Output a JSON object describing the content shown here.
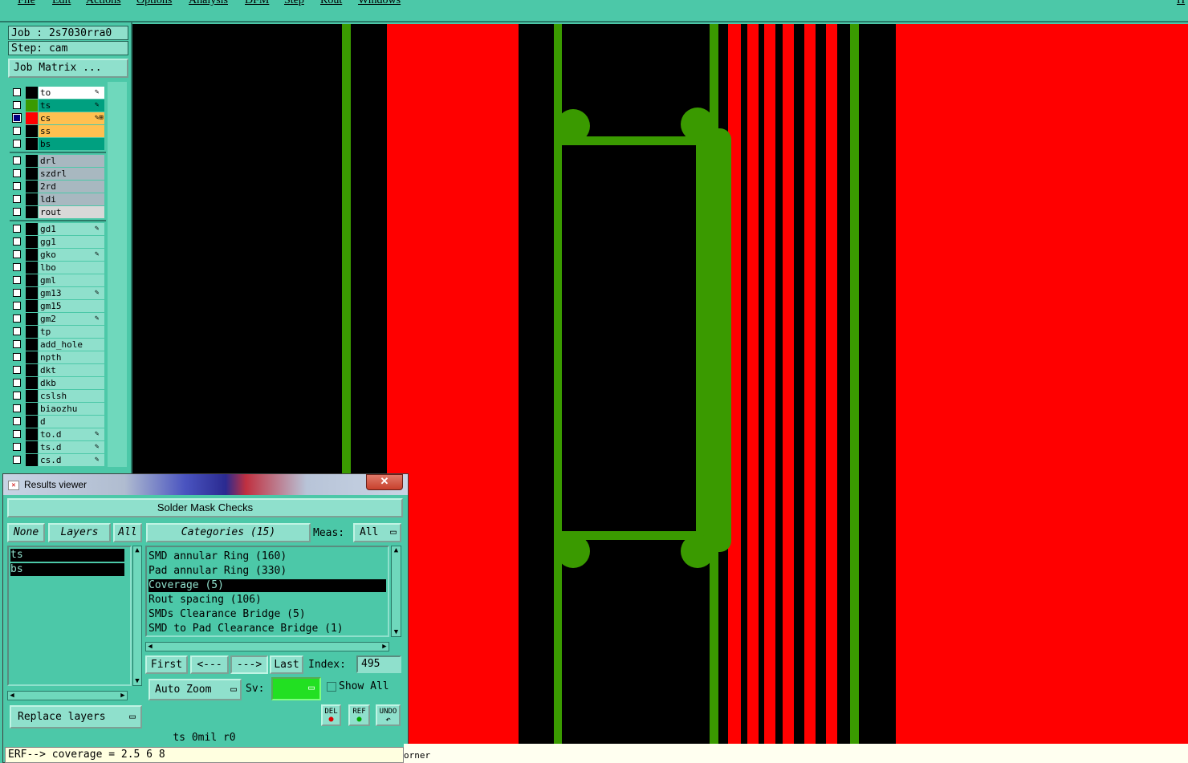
{
  "menubar": {
    "items": [
      "File",
      "Edit",
      "Actions",
      "Options",
      "Analysis",
      "DFM",
      "Step",
      "Rout",
      "Windows"
    ],
    "right_text": "H"
  },
  "job": {
    "job_label": "Job : 2s7030rra0",
    "step_label": "Step: cam",
    "matrix_button": "Job Matrix ..."
  },
  "layers": [
    {
      "name": "to",
      "color": "#ffffff",
      "swatch": "#000000",
      "marker": "✎",
      "checked": false
    },
    {
      "name": "ts",
      "color": "#00a080",
      "swatch": "#3a9a00",
      "marker": "✎",
      "checked": false
    },
    {
      "name": "cs",
      "color": "#ffc050",
      "swatch": "#ff0000",
      "marker": "✎⊞",
      "checked": true
    },
    {
      "name": "ss",
      "color": "#ffc050",
      "swatch": "#000000",
      "marker": "",
      "checked": false
    },
    {
      "name": "bs",
      "color": "#00a080",
      "swatch": "#000000",
      "marker": "",
      "checked": false
    },
    {
      "name": "drl",
      "color": "#a8b8c0",
      "swatch": "#000000",
      "marker": "",
      "checked": false
    },
    {
      "name": "szdrl",
      "color": "#a8b8c0",
      "swatch": "#000000",
      "marker": "",
      "checked": false
    },
    {
      "name": "2rd",
      "color": "#a8b8c0",
      "swatch": "#000000",
      "marker": "",
      "checked": false
    },
    {
      "name": "ldi",
      "color": "#a8b8c0",
      "swatch": "#000000",
      "marker": "",
      "checked": false
    },
    {
      "name": "rout",
      "color": "#d8d8d8",
      "swatch": "#000000",
      "marker": "",
      "checked": false
    },
    {
      "name": "gd1",
      "color": "#8fe0cc",
      "swatch": "#000000",
      "marker": "✎",
      "checked": false
    },
    {
      "name": "gg1",
      "color": "#8fe0cc",
      "swatch": "#000000",
      "marker": "",
      "checked": false
    },
    {
      "name": "gko",
      "color": "#8fe0cc",
      "swatch": "#000000",
      "marker": "✎",
      "checked": false
    },
    {
      "name": "lbo",
      "color": "#8fe0cc",
      "swatch": "#000000",
      "marker": "",
      "checked": false
    },
    {
      "name": "gml",
      "color": "#8fe0cc",
      "swatch": "#000000",
      "marker": "",
      "checked": false
    },
    {
      "name": "gm13",
      "color": "#8fe0cc",
      "swatch": "#000000",
      "marker": "✎",
      "checked": false
    },
    {
      "name": "gm15",
      "color": "#8fe0cc",
      "swatch": "#000000",
      "marker": "",
      "checked": false
    },
    {
      "name": "gm2",
      "color": "#8fe0cc",
      "swatch": "#000000",
      "marker": "✎",
      "checked": false
    },
    {
      "name": "tp",
      "color": "#8fe0cc",
      "swatch": "#000000",
      "marker": "",
      "checked": false
    },
    {
      "name": "add_hole",
      "color": "#8fe0cc",
      "swatch": "#000000",
      "marker": "",
      "checked": false
    },
    {
      "name": "npth",
      "color": "#8fe0cc",
      "swatch": "#000000",
      "marker": "",
      "checked": false
    },
    {
      "name": "dkt",
      "color": "#8fe0cc",
      "swatch": "#000000",
      "marker": "",
      "checked": false
    },
    {
      "name": "dkb",
      "color": "#8fe0cc",
      "swatch": "#000000",
      "marker": "",
      "checked": false
    },
    {
      "name": "cslsh",
      "color": "#8fe0cc",
      "swatch": "#000000",
      "marker": "",
      "checked": false
    },
    {
      "name": "biaozhu",
      "color": "#8fe0cc",
      "swatch": "#000000",
      "marker": "",
      "checked": false
    },
    {
      "name": "d",
      "color": "#8fe0cc",
      "swatch": "#000000",
      "marker": "",
      "checked": false
    },
    {
      "name": "to.d",
      "color": "#8fe0cc",
      "swatch": "#000000",
      "marker": "✎",
      "checked": false
    },
    {
      "name": "ts.d",
      "color": "#8fe0cc",
      "swatch": "#000000",
      "marker": "✎",
      "checked": false
    },
    {
      "name": "cs.d",
      "color": "#8fe0cc",
      "swatch": "#000000",
      "marker": "✎",
      "checked": false
    }
  ],
  "results_viewer": {
    "title": "Results viewer",
    "close": "✕",
    "header": "Solder Mask Checks",
    "none_btn": "None",
    "layers_btn": "Layers",
    "all_btn": "All",
    "categories_btn": "Categories (15)",
    "meas_label": "Meas:",
    "meas_value": "All",
    "layer_items": [
      "ts",
      "bs"
    ],
    "categories": [
      "SMD annular Ring (160)",
      "Pad annular Ring (330)",
      "Coverage (5)",
      "Rout spacing (106)",
      "SMDs Clearance Bridge (5)",
      "SMD to Pad Clearance Bridge (1)"
    ],
    "selected_category": 2,
    "first_btn": "First",
    "prev_btn": "<---",
    "next_btn": "--->",
    "last_btn": "Last",
    "index_label": "Index:",
    "index_value": "495",
    "zoom_mode": "Auto Zoom",
    "sv_label": "Sv:",
    "sv_color": "#22e022",
    "show_all": "Show All",
    "replace_layers": "Replace layers",
    "del_btn": "DEL",
    "ref_btn": "REF",
    "undo_btn": "UNDO",
    "status": "ts 0mil  r0"
  },
  "erf_line": "ERF--> coverage = 2.5 6 8",
  "bottom_hint": "orner",
  "colors": {
    "background": "#4cc8a8",
    "copper": "#ff0000",
    "mask": "#3a9a00",
    "canvas": "#000000"
  }
}
